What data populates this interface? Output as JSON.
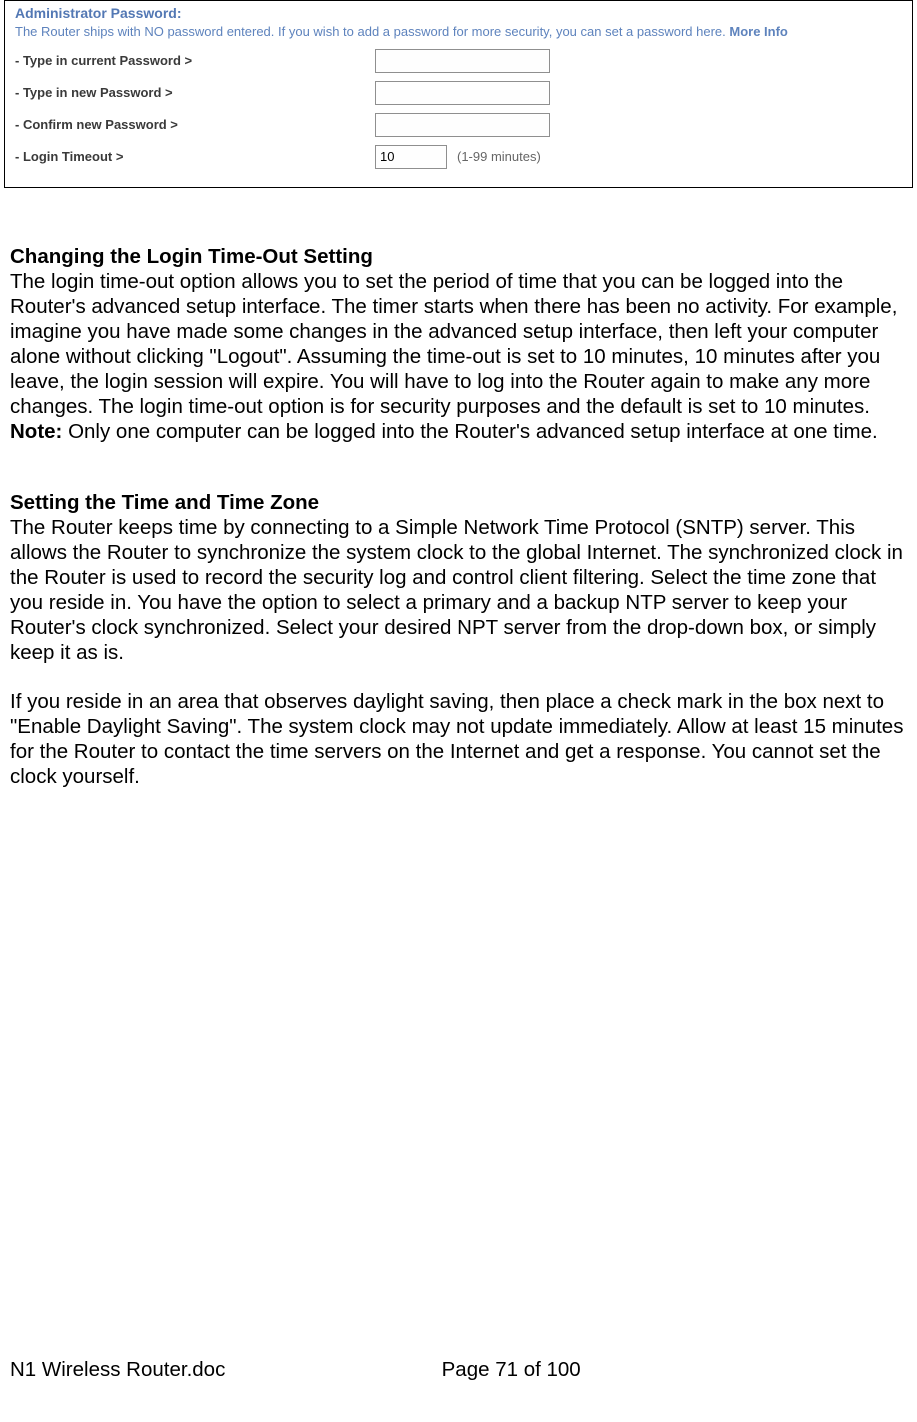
{
  "panel": {
    "title": "Administrator Password:",
    "desc": "The Router ships with NO password entered. If you wish to add a password for more security, you can set a password here. ",
    "more_info": "More Info",
    "fields": {
      "current": {
        "label": "- Type in current Password >",
        "value": ""
      },
      "new": {
        "label": "- Type in new Password >",
        "value": ""
      },
      "confirm": {
        "label": "- Confirm new Password >",
        "value": ""
      },
      "timeout": {
        "label": "- Login Timeout >",
        "value": "10",
        "suffix": "(1-99 minutes)"
      }
    }
  },
  "sections": {
    "s1": {
      "heading": "Changing the Login Time-Out Setting",
      "p1a": "The login time-out option allows you to set the period of time that you can be logged into the Router's advanced setup interface. The timer starts when there has been no activity. For example, imagine you have made some changes in the advanced setup interface, then left your computer alone without clicking \"Logout\". Assuming the time-out is set to 10 minutes, 10 minutes after you leave, the login session will expire. You will have to log into the Router again to make any more changes. The login time-out option is for security purposes and the default is set to 10 minutes. ",
      "note_label": "Note:",
      "p1b": " Only one computer can be logged into the Router's advanced setup interface at one time."
    },
    "s2": {
      "heading": "Setting the Time and Time Zone",
      "p1": "The Router keeps time by connecting to a Simple Network Time Protocol (SNTP) server. This allows the Router to synchronize the system clock to the global Internet. The synchronized clock in the Router is used to record the security log and control client filtering. Select the time zone that you reside in. You have the option to select a primary and a backup NTP server to keep your Router's clock synchronized. Select your desired NPT server from the drop-down box, or simply keep it as is.",
      "p2": "If you reside in an area that observes daylight saving, then place a check mark in the box next to \"Enable Daylight Saving\". The system clock may not update immediately. Allow at least 15 minutes for the Router to contact the time servers on the Internet and get a response. You cannot set the clock yourself."
    }
  },
  "footer": {
    "left": "N1 Wireless Router.doc",
    "center": "Page 71 of 100"
  }
}
